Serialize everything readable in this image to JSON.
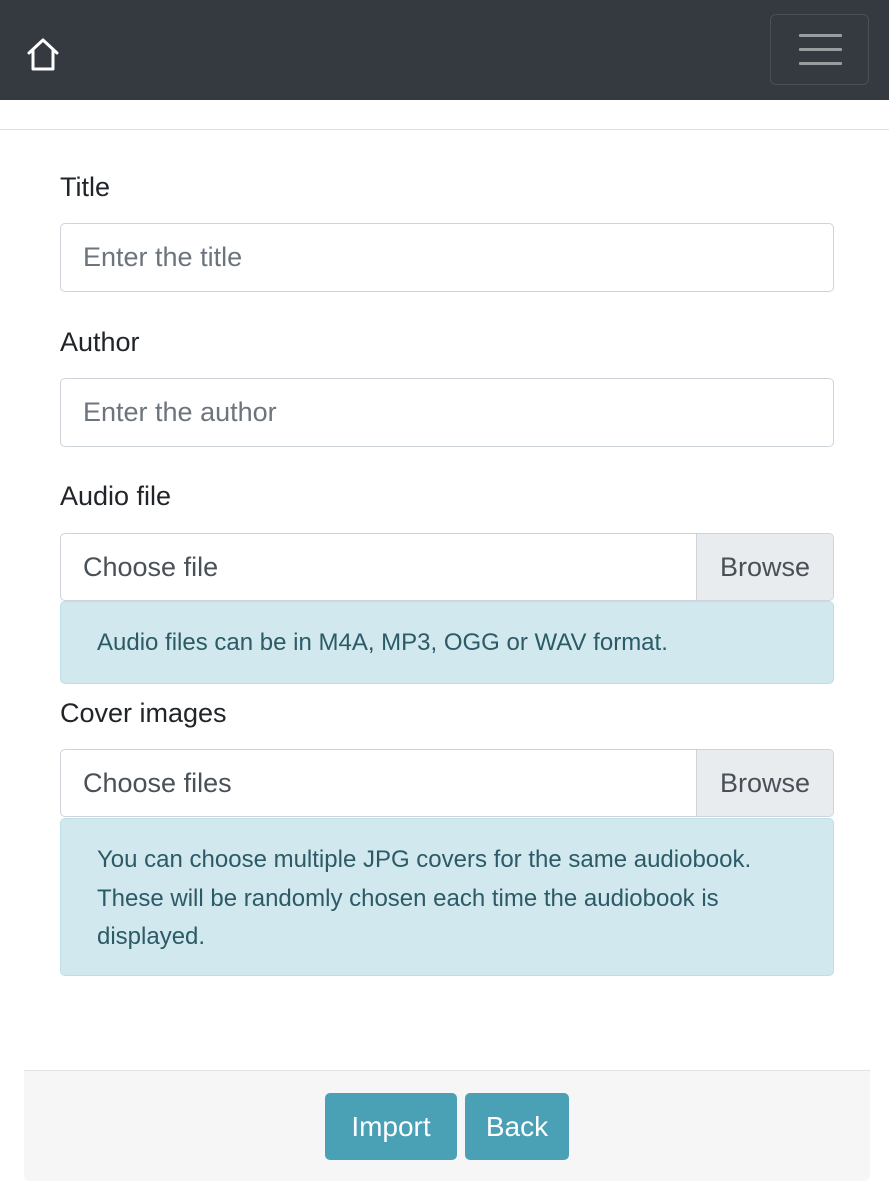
{
  "navbar": {
    "home_icon": "home-icon",
    "menu_icon": "hamburger-icon"
  },
  "form": {
    "title": {
      "label": "Title",
      "placeholder": "Enter the title",
      "value": ""
    },
    "author": {
      "label": "Author",
      "placeholder": "Enter the author",
      "value": ""
    },
    "audio_file": {
      "label": "Audio file",
      "file_label": "Choose file",
      "browse_label": "Browse",
      "help": "Audio files can be in M4A, MP3, OGG or WAV format."
    },
    "cover_images": {
      "label": "Cover images",
      "file_label": "Choose files",
      "browse_label": "Browse",
      "help_lines": [
        "You can choose multiple JPG covers for the same audiobook.",
        "These will be randomly chosen each time the audiobook is",
        "displayed."
      ]
    }
  },
  "footer": {
    "import_label": "Import",
    "back_label": "Back"
  },
  "colors": {
    "navbar_bg": "#343a40",
    "button_bg": "#4aa0b5",
    "alert_bg": "#d1e8ee"
  }
}
